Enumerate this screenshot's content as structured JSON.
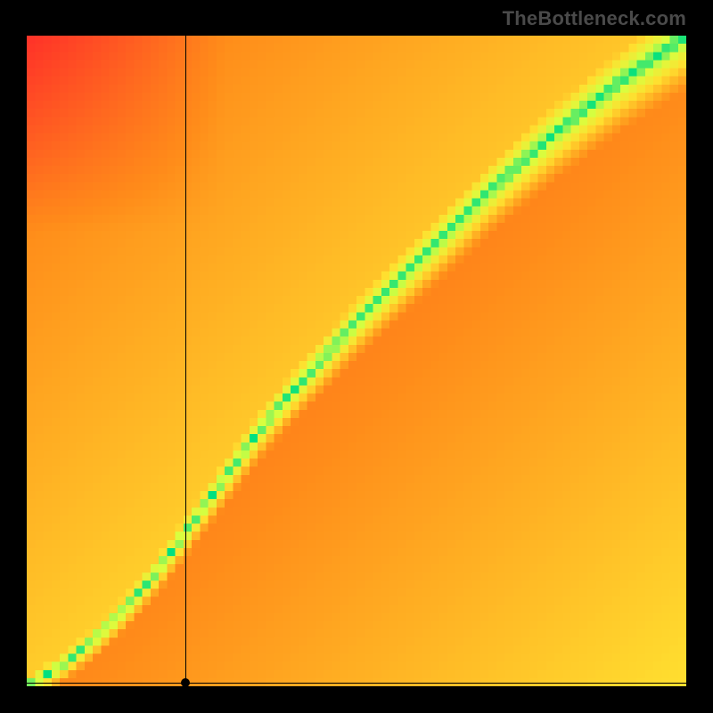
{
  "attribution": "TheBottleneck.com",
  "chart_data": {
    "type": "heatmap",
    "title": "",
    "xlabel": "",
    "ylabel": "",
    "xlim": [
      0,
      100
    ],
    "ylim": [
      0,
      100
    ],
    "grid_size": 80,
    "colormap": {
      "description": "Red→Orange→Yellow→Green→Yellow ramp; green where |y − f(x)| is small",
      "stops": [
        {
          "t": 0.0,
          "hex": "#ff2a2a"
        },
        {
          "t": 0.35,
          "hex": "#ff8c1a"
        },
        {
          "t": 0.6,
          "hex": "#ffe030"
        },
        {
          "t": 0.82,
          "hex": "#d8ff40"
        },
        {
          "t": 1.0,
          "hex": "#00e080"
        }
      ]
    },
    "ridge_curve": {
      "description": "Approximate locus of the green ridge (ideal pairing)",
      "points": [
        {
          "x": 0,
          "y": 0
        },
        {
          "x": 5,
          "y": 3
        },
        {
          "x": 10,
          "y": 7
        },
        {
          "x": 15,
          "y": 12
        },
        {
          "x": 20,
          "y": 18
        },
        {
          "x": 25,
          "y": 25
        },
        {
          "x": 30,
          "y": 32
        },
        {
          "x": 35,
          "y": 39
        },
        {
          "x": 40,
          "y": 45
        },
        {
          "x": 50,
          "y": 56
        },
        {
          "x": 60,
          "y": 66
        },
        {
          "x": 70,
          "y": 76
        },
        {
          "x": 80,
          "y": 85
        },
        {
          "x": 90,
          "y": 93
        },
        {
          "x": 100,
          "y": 100
        }
      ]
    },
    "ridge_width_fraction": 0.06,
    "crosshair": {
      "x": 24,
      "y": 0.5
    },
    "marker": {
      "x": 24,
      "y": 0.5
    }
  }
}
